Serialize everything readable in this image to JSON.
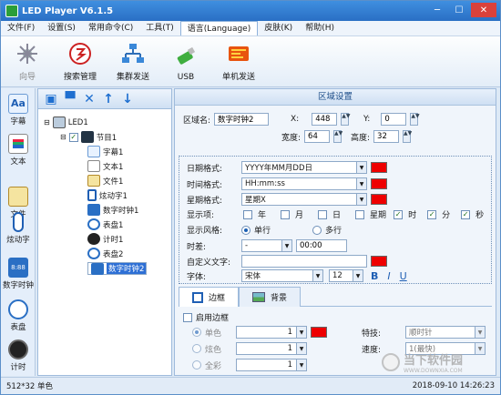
{
  "app": {
    "title": "LED Player V6.1.5"
  },
  "menu": [
    "文件(F)",
    "设置(S)",
    "常用命令(C)",
    "工具(T)",
    "语言(Language)",
    "皮肤(K)",
    "帮助(H)"
  ],
  "toolbar": {
    "items": [
      "向导",
      "搜索管理",
      "集群发送",
      "USB",
      "单机发送"
    ]
  },
  "leftbar": {
    "items": [
      "字幕",
      "文本",
      "文件",
      "炫动字",
      "数字时钟",
      "表盘",
      "计时"
    ]
  },
  "tree": {
    "root": "LED1",
    "program": "节目1",
    "items": [
      "字幕1",
      "文本1",
      "文件1",
      "炫动字1",
      "数字时钟1",
      "表盘1",
      "计时1",
      "表盘2",
      "数字时钟2"
    ]
  },
  "region": {
    "header": "区域设置",
    "name_label": "区域名:",
    "name_value": "数字时钟2",
    "x_label": "X:",
    "x_value": "448",
    "y_label": "Y:",
    "y_value": "0",
    "w_label": "宽度:",
    "w_value": "64",
    "h_label": "高度:",
    "h_value": "32"
  },
  "clock": {
    "date_label": "日期格式:",
    "date_value": "YYYY年MM月DD日",
    "time_label": "时间格式:",
    "time_value": "HH:mm:ss",
    "week_label": "星期格式:",
    "week_value": "星期X",
    "show_label": "显示项:",
    "show_items": [
      "年",
      "月",
      "日",
      "星期",
      "时",
      "分",
      "秒"
    ],
    "style_label": "显示风格:",
    "style_single": "单行",
    "style_multi": "多行",
    "diff_label": "时差:",
    "diff_sign": "-",
    "diff_value": "00:00",
    "custom_label": "自定义文字:",
    "font_label": "字体:",
    "font_value": "宋体",
    "size_value": "12",
    "bold": "B",
    "italic": "I",
    "underline": "U"
  },
  "tabs": {
    "border": "边框",
    "background": "背景"
  },
  "border": {
    "enable_label": "启用边框",
    "mono": "单色",
    "color": "炫色",
    "full": "全彩",
    "val1": "1",
    "val2": "1",
    "val3": "1",
    "effect_label": "特技:",
    "effect_value": "顺时针",
    "speed_label": "速度:",
    "speed_value": "1(最快)"
  },
  "status": {
    "left": "512*32 单色",
    "right": "2018-09-10 14:26:23"
  },
  "watermark": {
    "text": "当下软件园",
    "sub": "WWW.DOWNXIA.COM"
  },
  "colors": {
    "red": "#e80000",
    "accent": "#2a6fc4"
  }
}
